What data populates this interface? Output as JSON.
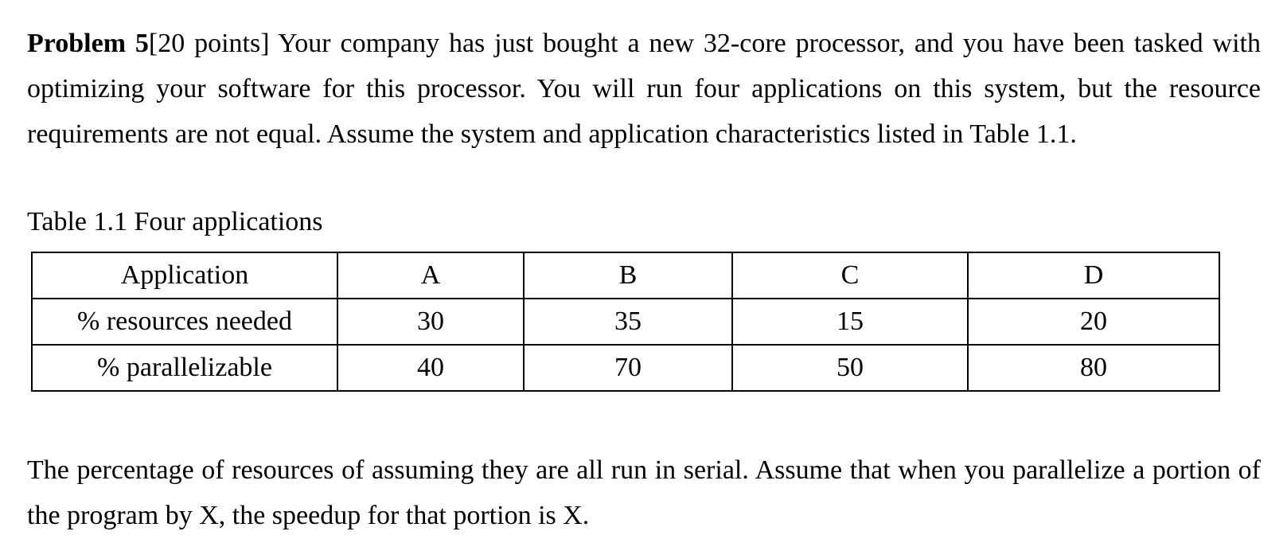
{
  "problem": {
    "title": "Problem 5",
    "points": "[20 points]",
    "intro": " Your company has just bought a new 32-core processor, and you have been tasked with optimizing your software for this processor. You will run four applications on this system, but the resource requirements are not equal. Assume the system and application characteristics listed in Table 1.1."
  },
  "table": {
    "caption": "Table 1.1 Four applications",
    "header": [
      "Application",
      "A",
      "B",
      "C",
      "D"
    ],
    "rows": [
      [
        "% resources needed",
        "30",
        "35",
        "15",
        "20"
      ],
      [
        "% parallelizable",
        "40",
        "70",
        "50",
        "80"
      ]
    ]
  },
  "closing": "The percentage of resources of assuming they are all run in serial. Assume that when you parallelize a portion of the program by X, the speedup for that portion is X."
}
